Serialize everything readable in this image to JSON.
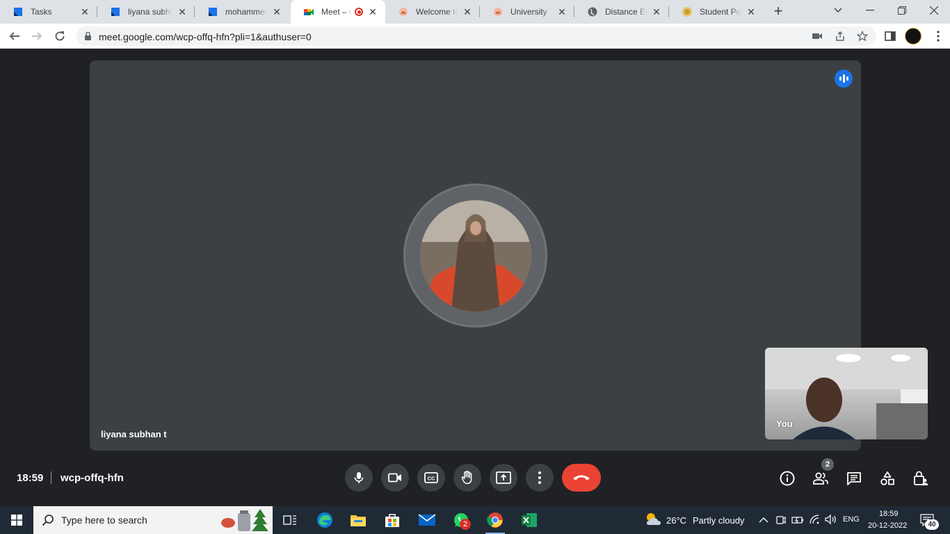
{
  "browser": {
    "tabs": [
      {
        "title": "Tasks",
        "icon": "tasks-icon"
      },
      {
        "title": "liyana subhan",
        "icon": "tasks-icon"
      },
      {
        "title": "mohammed S",
        "icon": "tasks-icon"
      },
      {
        "title": "Meet – w",
        "icon": "meet-icon",
        "active": true,
        "recording": true
      },
      {
        "title": "Welcome to U",
        "icon": "university-icon"
      },
      {
        "title": "University",
        "icon": "university-icon"
      },
      {
        "title": "Distance Educ",
        "icon": "globe-icon"
      },
      {
        "title": "Student Porta",
        "icon": "portal-icon"
      }
    ],
    "new_tab": "+",
    "url": "meet.google.com/wcp-offq-hfn?pli=1&authuser=0"
  },
  "meet": {
    "participant_name": "liyana subhan t",
    "self_label": "You",
    "time": "18:59",
    "meeting_code": "wcp-offq-hfn",
    "participants_count": "2",
    "colors": {
      "end_call": "#ea4335",
      "speaking": "#1a73e8",
      "tile": "#3c4043",
      "background": "#202124"
    }
  },
  "taskbar": {
    "search_placeholder": "Type here to search",
    "weather_temp": "26°C",
    "weather_desc": "Partly cloudy",
    "language": "ENG",
    "time": "18:59",
    "date": "20-12-2022",
    "notification_count": "40",
    "whatsapp_badge": "2"
  }
}
